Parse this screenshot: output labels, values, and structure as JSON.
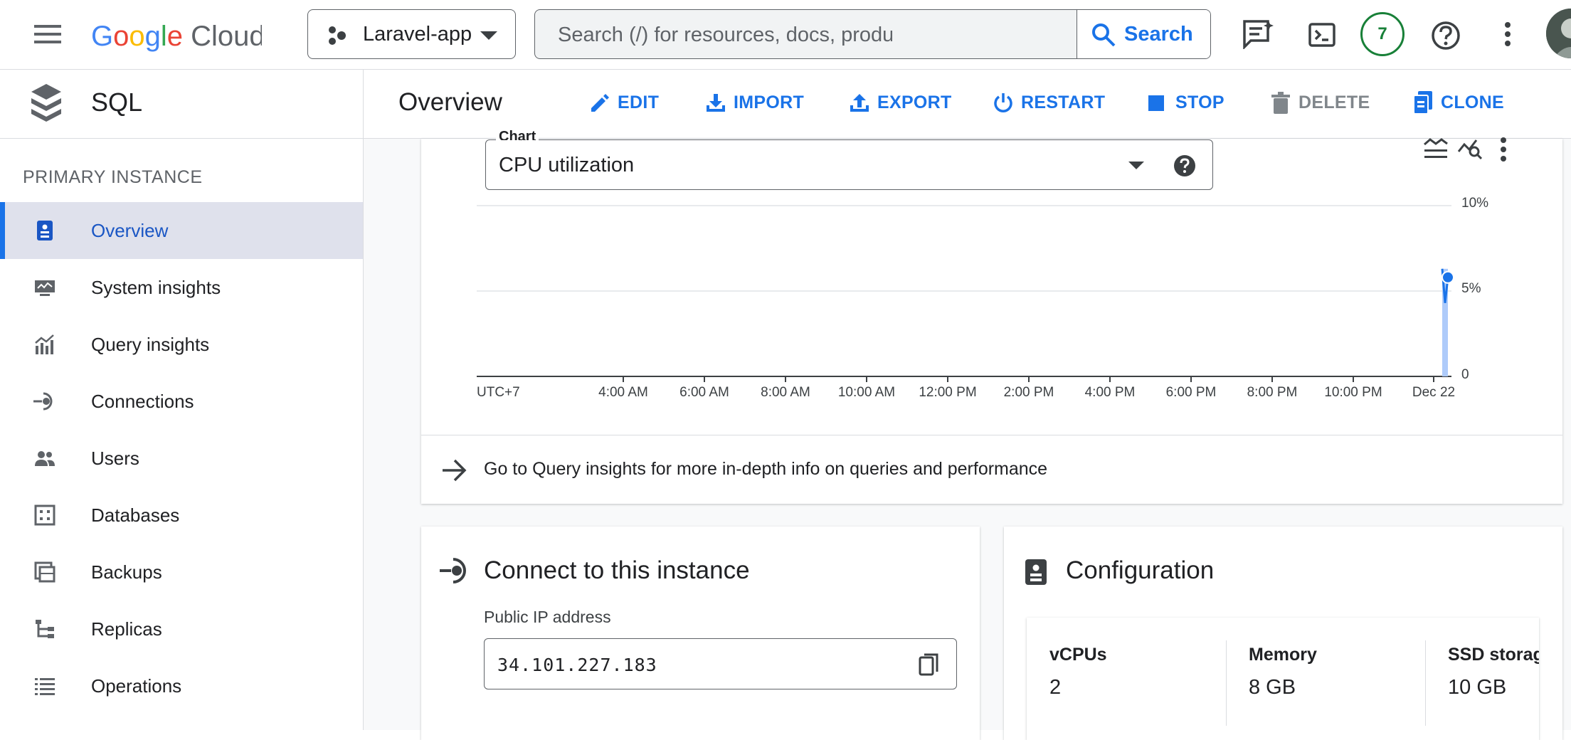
{
  "topbar": {
    "logo_text": "Google Cloud",
    "project_name": "Laravel-app",
    "search_placeholder": "Search (/) for resources, docs, products, and mo…",
    "search_button": "Search",
    "notifications_count": "7"
  },
  "subbar": {
    "product_title": "SQL",
    "page_title": "Overview",
    "actions": [
      {
        "label": "EDIT",
        "enabled": true
      },
      {
        "label": "IMPORT",
        "enabled": true
      },
      {
        "label": "EXPORT",
        "enabled": true
      },
      {
        "label": "RESTART",
        "enabled": true
      },
      {
        "label": "STOP",
        "enabled": true
      },
      {
        "label": "DELETE",
        "enabled": false
      },
      {
        "label": "CLONE",
        "enabled": true
      }
    ]
  },
  "sidebar": {
    "section_title": "PRIMARY INSTANCE",
    "items": [
      {
        "label": "Overview",
        "icon": "overview-icon",
        "active": true
      },
      {
        "label": "System insights",
        "icon": "monitor-icon",
        "active": false
      },
      {
        "label": "Query insights",
        "icon": "insights-chart-icon",
        "active": false
      },
      {
        "label": "Connections",
        "icon": "connection-icon",
        "active": false
      },
      {
        "label": "Users",
        "icon": "users-icon",
        "active": false
      },
      {
        "label": "Databases",
        "icon": "database-grid-icon",
        "active": false
      },
      {
        "label": "Backups",
        "icon": "backup-icon",
        "active": false
      },
      {
        "label": "Replicas",
        "icon": "replicas-icon",
        "active": false
      },
      {
        "label": "Operations",
        "icon": "list-icon",
        "active": false
      }
    ]
  },
  "chart_panel": {
    "select_label": "Chart",
    "selected_metric": "CPU utilization"
  },
  "chart_data": {
    "type": "line",
    "title": "CPU utilization",
    "timezone_label": "UTC+7",
    "x_tick_labels": [
      "4:00 AM",
      "6:00 AM",
      "8:00 AM",
      "10:00 AM",
      "12:00 PM",
      "2:00 PM",
      "4:00 PM",
      "6:00 PM",
      "8:00 PM",
      "10:00 PM",
      "Dec 22"
    ],
    "y_tick_labels": [
      "10%",
      "5%",
      "0"
    ],
    "ylim": [
      0,
      10
    ],
    "grid": true,
    "series": [
      {
        "values_percent": [
          6.3,
          4.3,
          5.8
        ],
        "x_position": "just after Dec 22",
        "color": "#1a73e8"
      }
    ]
  },
  "query_insights_link": "Go to Query insights for more in-depth info on queries and performance",
  "connect_card": {
    "title": "Connect to this instance",
    "ip_label": "Public IP address",
    "ip_value": "34.101.227.183"
  },
  "config_card": {
    "title": "Configuration",
    "items": [
      {
        "label": "vCPUs",
        "value": "2"
      },
      {
        "label": "Memory",
        "value": "8 GB"
      },
      {
        "label": "SSD storag",
        "value": "10 GB"
      }
    ]
  },
  "colors": {
    "accent": "#1a73e8",
    "active_bg": "#dfe1ec",
    "badge_green": "#188038"
  }
}
